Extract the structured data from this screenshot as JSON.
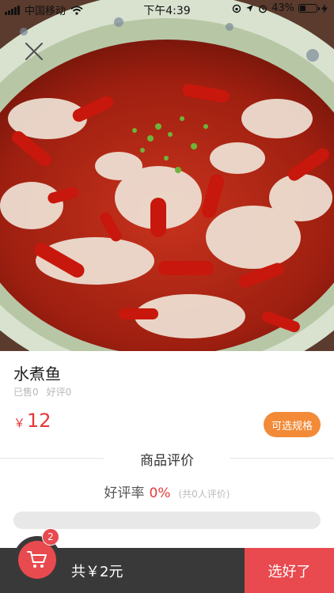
{
  "status_bar": {
    "carrier": "中国移动",
    "time": "下午4:39",
    "battery": "43%",
    "battery_level": 0.43
  },
  "product": {
    "name": "水煮鱼",
    "sold": "已售0",
    "good_reviews": "好评0",
    "currency": "￥",
    "price": "12",
    "spec_button": "可选规格"
  },
  "reviews": {
    "title": "商品评价",
    "rate_label": "好评率",
    "rate_value": "0%",
    "rate_fraction": 0,
    "count_text": "(共0人评价)"
  },
  "cart": {
    "badge": "2",
    "total": "共￥2元",
    "confirm": "选好了"
  },
  "icons": {
    "close": "close-icon",
    "cart": "shopping-cart-icon",
    "wifi": "wifi-icon",
    "signal": "signal-icon",
    "battery": "battery-icon"
  },
  "colors": {
    "accent_red": "#e84a4f",
    "price_red": "#e53838",
    "spec_orange": "#f28a37",
    "bottom_bar": "#3a3939"
  }
}
